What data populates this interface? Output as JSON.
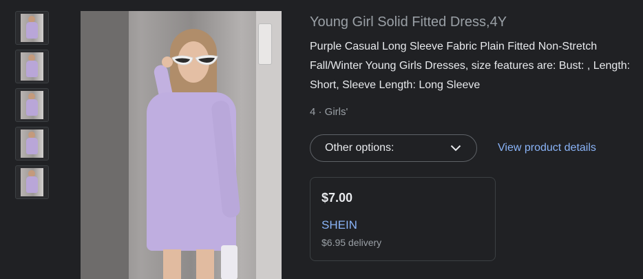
{
  "product": {
    "title": "Young Girl Solid Fitted Dress,4Y",
    "description": "Purple Casual Long Sleeve Fabric Plain Fitted Non-Stretch Fall/Winter Young Girls Dresses, size features are: Bust: , Length: Short, Sleeve Length: Long Sleeve",
    "meta": "4 · Girls'"
  },
  "options": {
    "label": "Other options:",
    "icon": "chevron-down-icon"
  },
  "links": {
    "view_details": "View product details"
  },
  "offer": {
    "price": "$7.00",
    "seller": "SHEIN",
    "delivery": "$6.95 delivery"
  },
  "colors": {
    "background": "#202124",
    "link": "#8ab4f8",
    "muted": "#9aa0a6",
    "dress": "#bfaee0"
  }
}
